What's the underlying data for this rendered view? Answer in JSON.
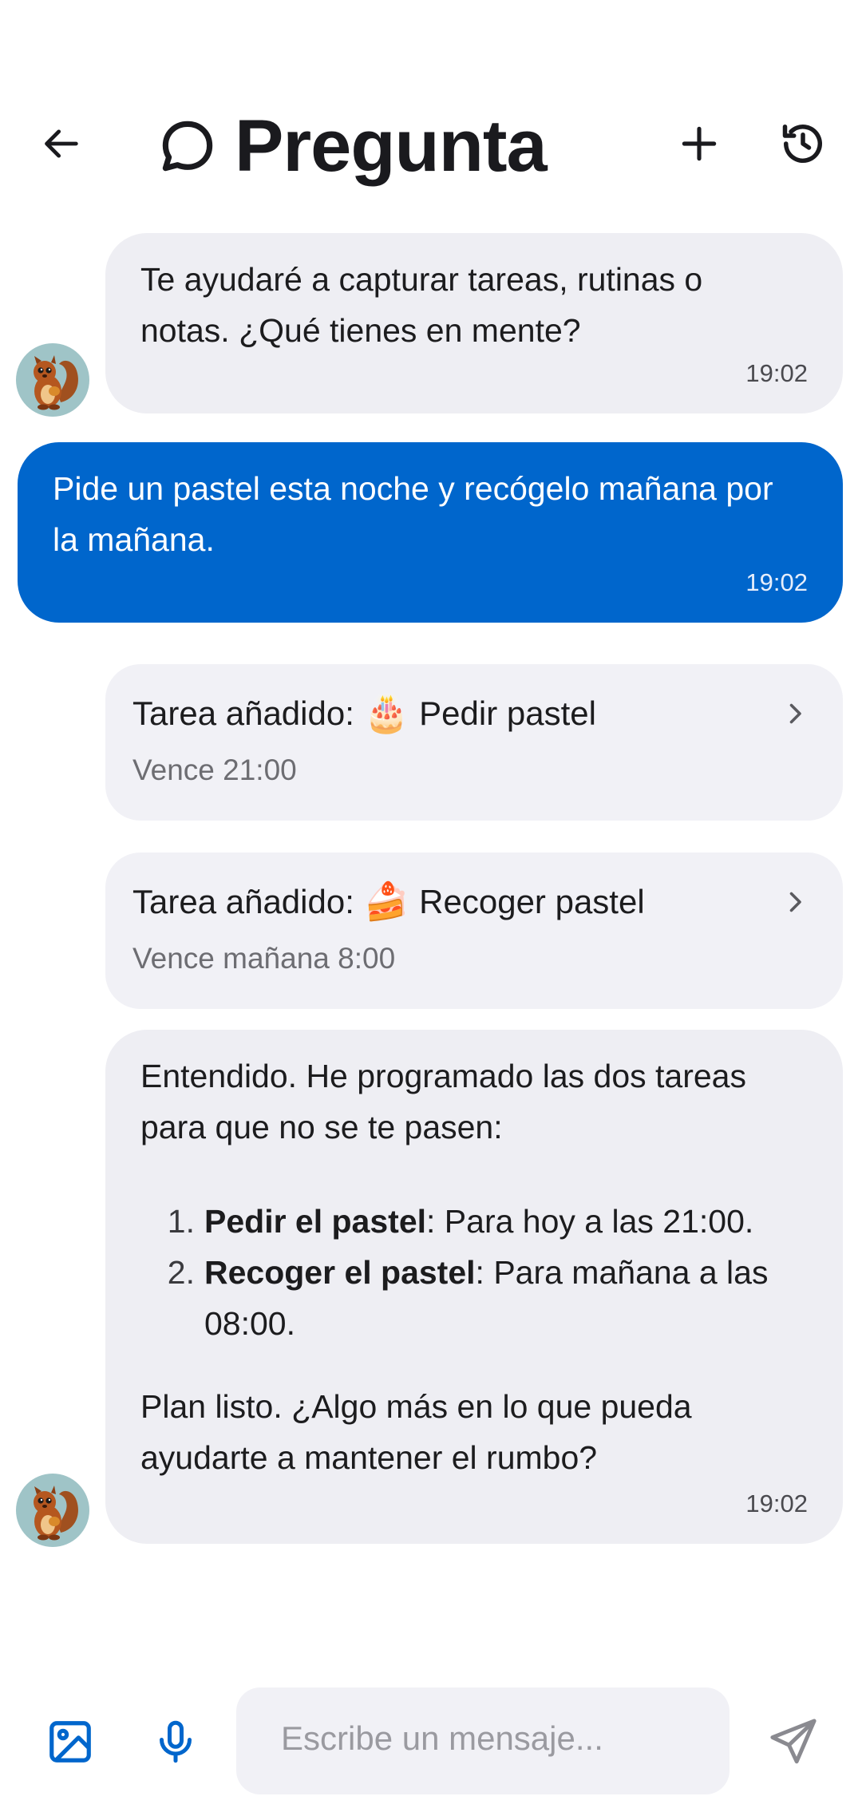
{
  "header": {
    "title": "Pregunta",
    "back_icon": "arrow-left-icon",
    "title_icon": "chat-bubble-icon",
    "new_icon": "plus-icon",
    "history_icon": "history-icon"
  },
  "messages": [
    {
      "from": "assistant",
      "text": "Te ayudaré a capturar tareas, rutinas o notas. ¿Qué tienes en mente?",
      "time": "19:02"
    },
    {
      "from": "user",
      "text": "Pide un pastel esta noche y recógelo mañana por la mañana.",
      "time": "19:02"
    }
  ],
  "tasks": [
    {
      "prefix": "Tarea añadido:",
      "emoji": "🎂",
      "name": "Pedir pastel",
      "due": "Vence 21:00"
    },
    {
      "prefix": "Tarea añadido:",
      "emoji": "🍰",
      "name": "Recoger pastel",
      "due": "Vence mañana 8:00"
    }
  ],
  "final_message": {
    "intro": "Entendido. He programado las dos tareas para que no se te pasen:",
    "items": [
      {
        "num": "1.",
        "bold": "Pedir el pastel",
        "rest": ": Para hoy a las 21:00."
      },
      {
        "num": "2.",
        "bold": "Recoger el pastel",
        "rest": ": Para mañana a las 08:00."
      }
    ],
    "outro": "Plan listo. ¿Algo más en lo que pueda ayudarte a mantener el rumbo?",
    "time": "19:02"
  },
  "composer": {
    "placeholder": "Escribe un mensaje...",
    "image_icon": "image-icon",
    "mic_icon": "microphone-icon",
    "send_icon": "send-icon"
  },
  "colors": {
    "accent": "#0066cc",
    "bubble": "#eeeef3",
    "card": "#f1f1f6"
  }
}
